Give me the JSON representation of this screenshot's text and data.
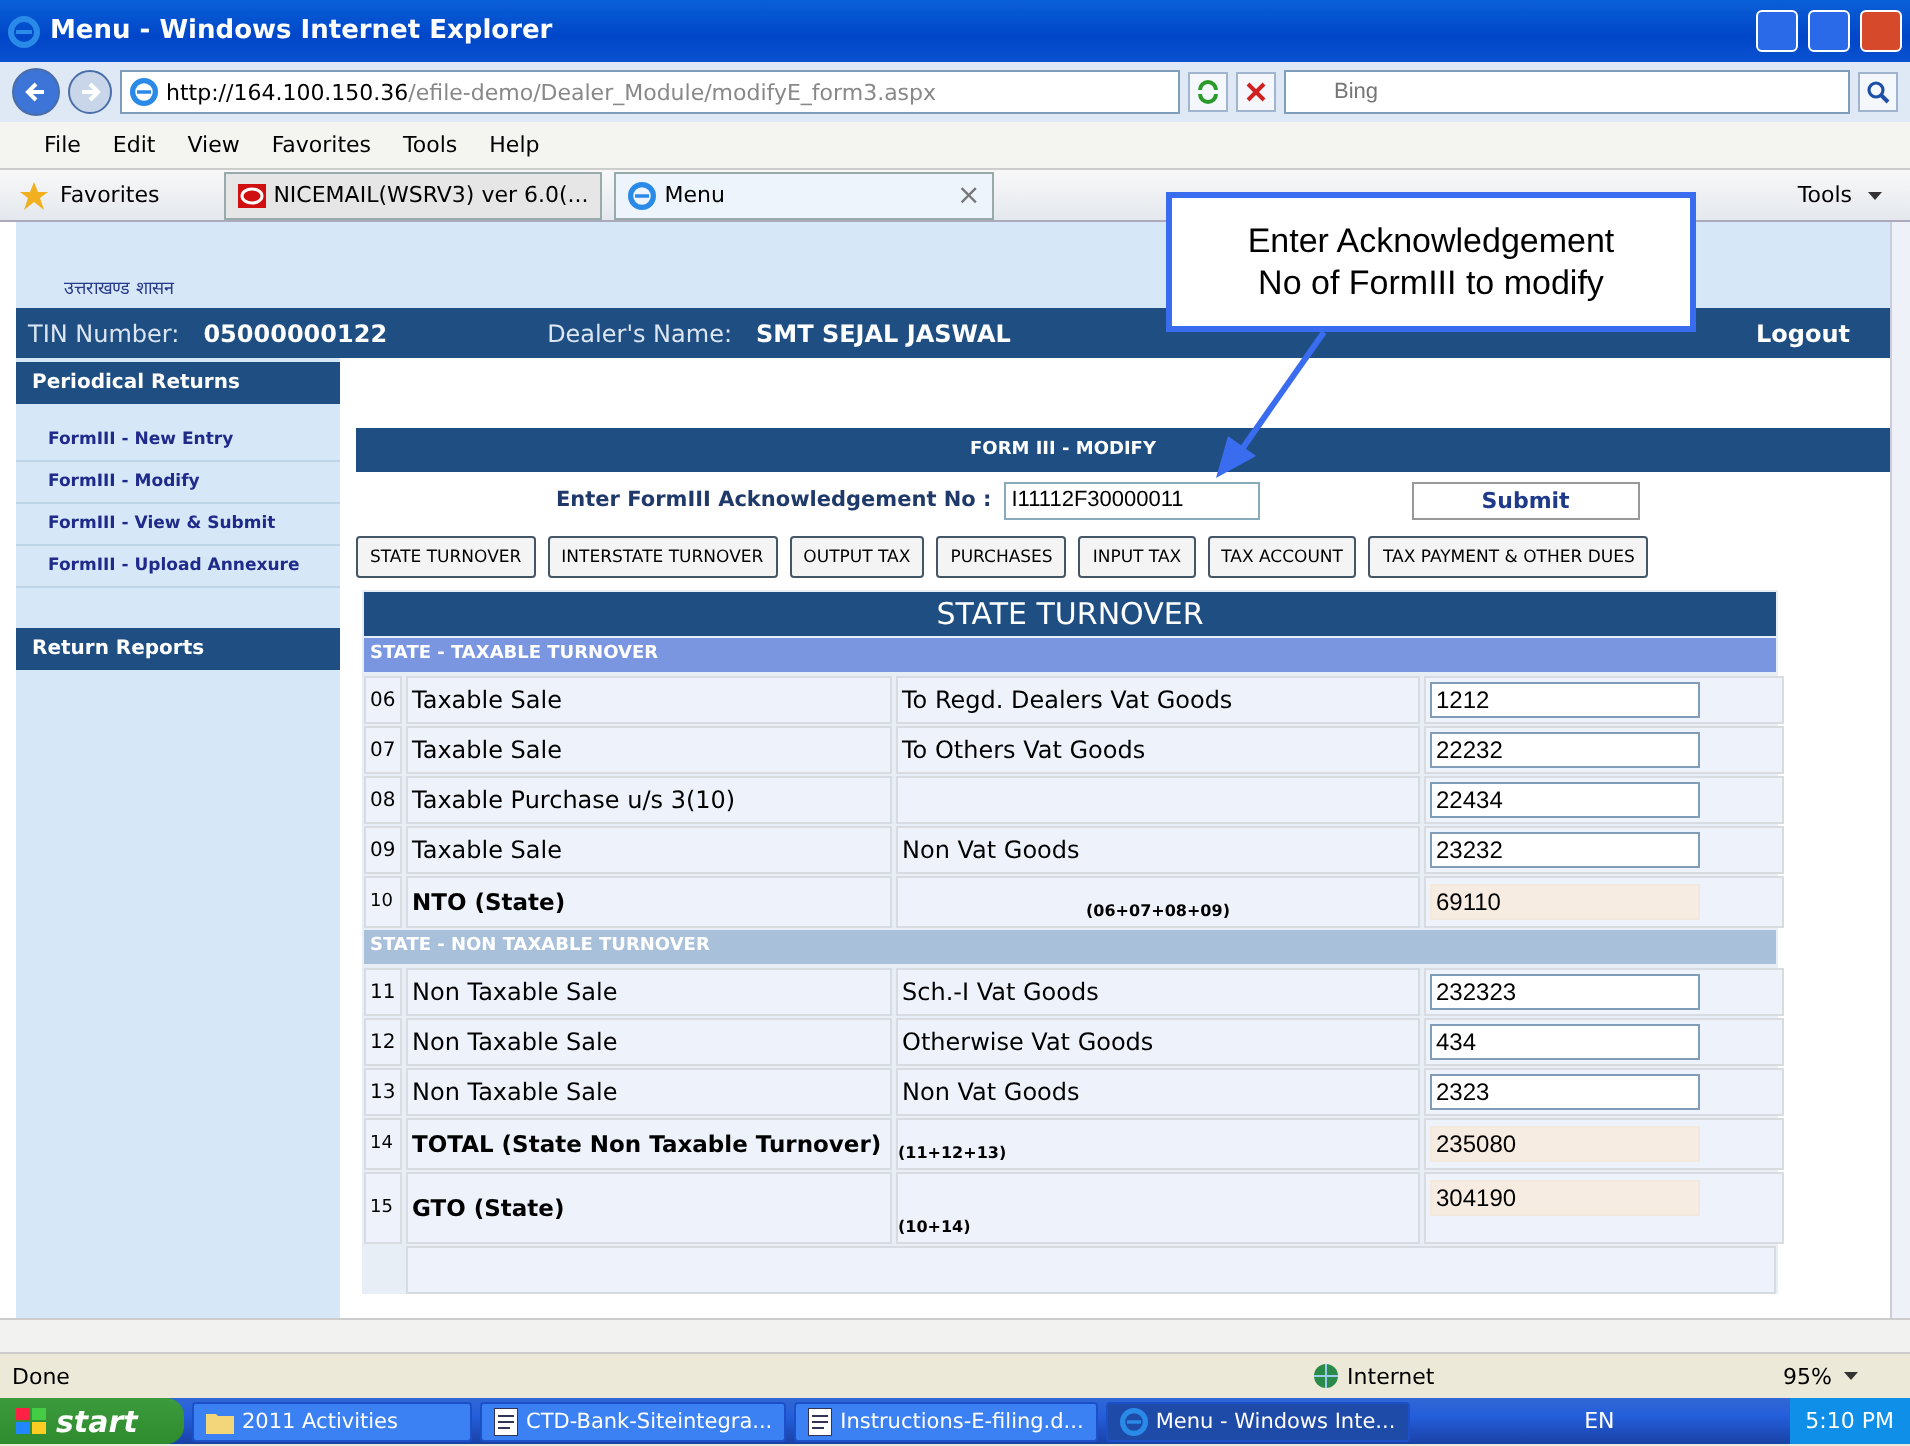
{
  "window": {
    "title": "Menu - Windows Internet Explorer"
  },
  "address_bar": {
    "url_host": "http://164.100.150.36",
    "url_path": "/efile-demo/Dealer_Module/modifyE_form3.aspx",
    "search_placeholder": "Bing"
  },
  "menu": [
    "File",
    "Edit",
    "View",
    "Favorites",
    "Tools",
    "Help"
  ],
  "favorites_bar": {
    "favorites": "Favorites",
    "tabs": [
      {
        "label": "NICEMAIL(WSRV3) ver 6.0(...",
        "selected": false
      },
      {
        "label": "Menu",
        "selected": true,
        "close": "×"
      }
    ],
    "tools": "Tools"
  },
  "page": {
    "logo_caption": "उत्तराखण्ड शासन",
    "tin_label": "TIN Number:",
    "tin": "05000000122",
    "dealer_label": "Dealer's Name:",
    "dealer": "SMT SEJAL JASWAL",
    "logout": "Logout",
    "sidebar": [
      {
        "title": "Periodical Returns",
        "items": [
          "FormIII - New Entry",
          "FormIII - Modify",
          "FormIII - View & Submit",
          "FormIII - Upload Annexure"
        ]
      },
      {
        "title": "Return Reports"
      }
    ],
    "form": {
      "title": "FORM III - MODIFY",
      "ack_label": "Enter FormIII Acknowledgement No :",
      "ack_value": "I11112F30000011",
      "submit": "Submit"
    },
    "section_tabs": [
      "STATE TURNOVER",
      "INTERSTATE TURNOVER",
      "OUTPUT TAX",
      "PURCHASES",
      "INPUT TAX",
      "TAX ACCOUNT",
      "TAX PAYMENT & OTHER DUES"
    ],
    "table": {
      "title": "STATE TURNOVER",
      "groups": [
        {
          "heading": "STATE - TAXABLE TURNOVER",
          "selected": true,
          "rows": [
            {
              "kind": "entry",
              "no": "06",
              "item": "Taxable Sale",
              "detail": "To Regd. Dealers Vat Goods",
              "value": "1212"
            },
            {
              "kind": "entry",
              "no": "07",
              "item": "Taxable Sale",
              "detail": "To Others Vat Goods",
              "value": "22232"
            },
            {
              "kind": "entry",
              "no": "08",
              "item": "Taxable Purchase u/s 3(10)",
              "value": "22434"
            },
            {
              "kind": "entry",
              "no": "09",
              "item": "Taxable Sale",
              "detail": "Non Vat Goods",
              "value": "23232"
            },
            {
              "kind": "total",
              "no": "10",
              "item": "NTO (State)",
              "formula": "(06+07+08+09)",
              "value": "69110"
            }
          ]
        },
        {
          "heading": "STATE - NON TAXABLE TURNOVER",
          "selected": false,
          "rows": [
            {
              "kind": "entry",
              "no": "11",
              "item": "Non Taxable Sale",
              "detail": "Sch.-I  Vat Goods",
              "value": "232323"
            },
            {
              "kind": "entry",
              "no": "12",
              "item": "Non Taxable Sale",
              "detail": "Otherwise Vat Goods",
              "value": "434"
            },
            {
              "kind": "entry",
              "no": "13",
              "item": "Non Taxable Sale",
              "detail": "Non Vat Goods",
              "value": "2323"
            },
            {
              "kind": "total",
              "no": "14",
              "item": "TOTAL  (State Non Taxable Turnover)",
              "formula": "(11+12+13)",
              "value": "235080"
            },
            {
              "kind": "total",
              "no": "15",
              "item": "GTO (State)",
              "formula": "(10+14)",
              "value": "304190"
            }
          ]
        }
      ]
    }
  },
  "callout": {
    "lines": [
      "Enter Acknowledgement",
      "No of FormIII to modify"
    ]
  },
  "status_bar": {
    "text": "Done",
    "zone": "Internet",
    "zoom": "95%"
  },
  "taskbar": {
    "start": "start",
    "tasks": [
      {
        "label": "2011 Activities",
        "kind": "folder",
        "selected": false
      },
      {
        "label": "CTD-Bank-Siteintegra...",
        "kind": "document",
        "selected": false
      },
      {
        "label": "Instructions-E-filing.d...",
        "kind": "document",
        "selected": false
      },
      {
        "label": "Menu - Windows Inte...",
        "kind": "browser",
        "selected": true
      }
    ],
    "language": "EN",
    "clock": "5:10 PM"
  }
}
